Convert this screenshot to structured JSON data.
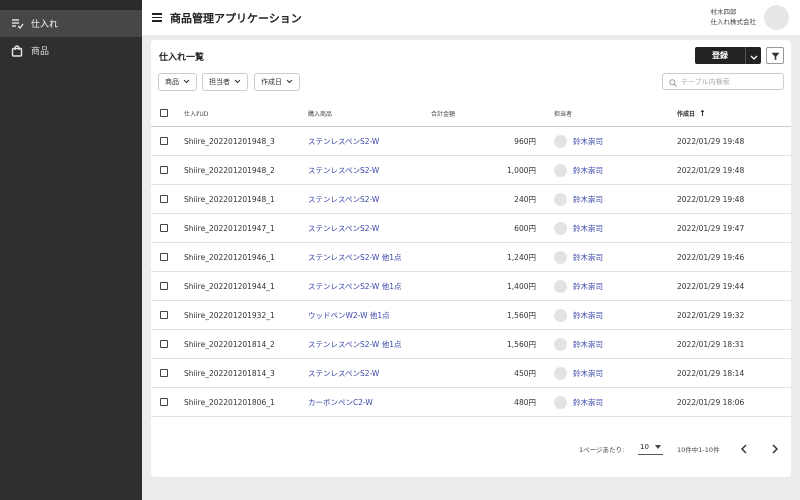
{
  "sidebar": {
    "items": [
      {
        "label": "仕入れ",
        "icon": "purchase-list-icon",
        "active": true
      },
      {
        "label": "商品",
        "icon": "shopping-bag-icon",
        "active": false
      }
    ]
  },
  "header": {
    "title": "商品管理アプリケーション",
    "user_name": "村木四郎",
    "company": "仕入れ株式会社"
  },
  "card": {
    "title": "仕入れ一覧",
    "register_label": "登録",
    "filters": [
      "商品",
      "担当者",
      "作成日"
    ],
    "search_placeholder": "テーブル内検索"
  },
  "table": {
    "headers": {
      "id": "仕入れID",
      "product": "購入商品",
      "amount": "合計金額",
      "user": "担当者",
      "date": "作成日"
    },
    "sort_indicator": "↑",
    "rows": [
      {
        "id": "Shiire_202201201948_3",
        "product": "ステンレスペンS2-W",
        "amount": "960円",
        "user": "鈴木崇司",
        "date": "2022/01/29 19:48"
      },
      {
        "id": "Shiire_202201201948_2",
        "product": "ステンレスペンS2-W",
        "amount": "1,000円",
        "user": "鈴木崇司",
        "date": "2022/01/29 19:48"
      },
      {
        "id": "Shiire_202201201948_1",
        "product": "ステンレスペンS2-W",
        "amount": "240円",
        "user": "鈴木崇司",
        "date": "2022/01/29 19:48"
      },
      {
        "id": "Shiire_202201201947_1",
        "product": "ステンレスペンS2-W",
        "amount": "600円",
        "user": "鈴木崇司",
        "date": "2022/01/29 19:47"
      },
      {
        "id": "Shiire_202201201946_1",
        "product": "ステンレスペンS2-W 他1点",
        "amount": "1,240円",
        "user": "鈴木崇司",
        "date": "2022/01/29 19:46"
      },
      {
        "id": "Shiire_202201201944_1",
        "product": "ステンレスペンS2-W 他1点",
        "amount": "1,400円",
        "user": "鈴木崇司",
        "date": "2022/01/29 19:44"
      },
      {
        "id": "Shiire_202201201932_1",
        "product": "ウッドペンW2-W 他1点",
        "amount": "1,560円",
        "user": "鈴木崇司",
        "date": "2022/01/29 19:32"
      },
      {
        "id": "Shiire_202201201814_2",
        "product": "ステンレスペンS2-W 他1点",
        "amount": "1,560円",
        "user": "鈴木崇司",
        "date": "2022/01/29 18:31"
      },
      {
        "id": "Shiire_202201201814_3",
        "product": "ステンレスペンS2-W",
        "amount": "450円",
        "user": "鈴木崇司",
        "date": "2022/01/29 18:14"
      },
      {
        "id": "Shiire_202201201806_1",
        "product": "カーボンペンC2-W",
        "amount": "480円",
        "user": "鈴木崇司",
        "date": "2022/01/29 18:06"
      }
    ]
  },
  "pagination": {
    "per_page_label": "1ページあたり:",
    "per_page_value": "10",
    "range_text": "10件中1-10件"
  },
  "colors": {
    "sidebar_bg": "#2f2f2f",
    "link": "#3a46a8",
    "primary_button": "#222222"
  }
}
